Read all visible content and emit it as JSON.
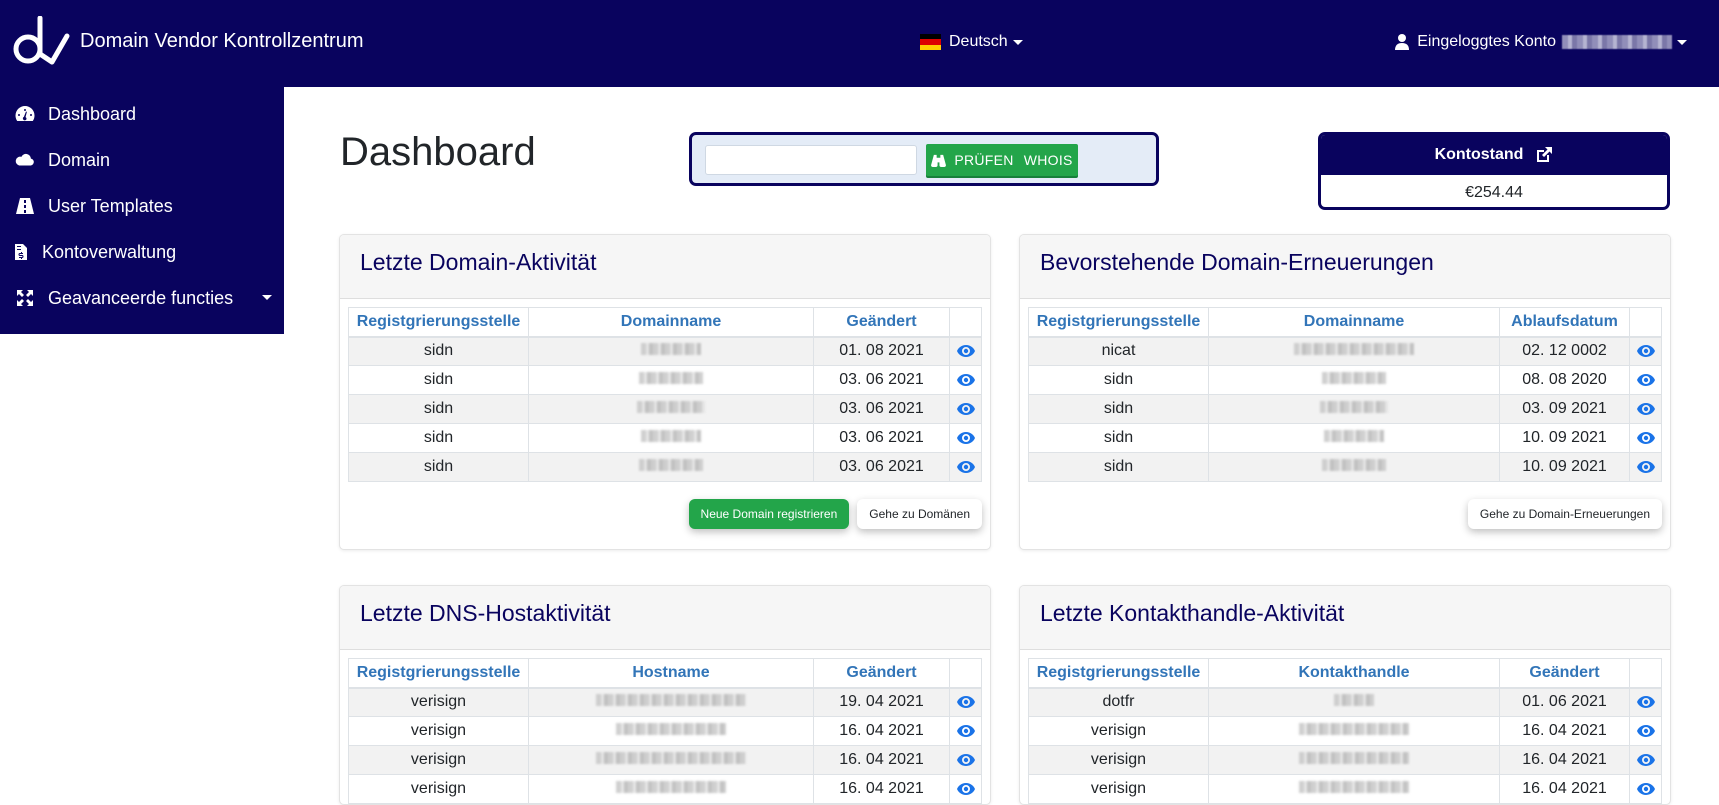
{
  "app": {
    "title": "Domain Vendor Kontrollzentrum",
    "language": "Deutsch",
    "account_label": "Eingeloggtes Konto",
    "account_name_redacted": true
  },
  "sidebar": {
    "items": [
      {
        "label": "Dashboard",
        "icon": "tachometer-icon"
      },
      {
        "label": "Domain",
        "icon": "cloud-icon"
      },
      {
        "label": "User Templates",
        "icon": "road-icon"
      },
      {
        "label": "Kontoverwaltung",
        "icon": "invoice-icon"
      },
      {
        "label": "Geavanceerde functies",
        "icon": "expand-arrows-icon",
        "has_dropdown": true
      }
    ]
  },
  "page": {
    "title": "Dashboard"
  },
  "whois": {
    "input_value": "",
    "button_label_1": "PRÜFEN",
    "button_label_2": "WHOIS"
  },
  "balance": {
    "label": "Kontostand",
    "value": "€254.44"
  },
  "cards": {
    "domain_activity": {
      "title": "Letzte Domain-Aktivität",
      "headers": [
        "Registgrierungsstelle",
        "Domainname",
        "Geändert"
      ],
      "rows": [
        {
          "registry": "sidn",
          "name": "[redacted]",
          "date": "01. 08 2021"
        },
        {
          "registry": "sidn",
          "name": "[redacted]",
          "date": "03. 06 2021"
        },
        {
          "registry": "sidn",
          "name": "[redacted]",
          "date": "03. 06 2021"
        },
        {
          "registry": "sidn",
          "name": "[redacted]",
          "date": "03. 06 2021"
        },
        {
          "registry": "sidn",
          "name": "[redacted]",
          "date": "03. 06 2021"
        }
      ],
      "buttons": [
        "Neue Domain registrieren",
        "Gehe zu Domänen"
      ]
    },
    "renewals": {
      "title": "Bevorstehende Domain-Erneuerungen",
      "headers": [
        "Registgrierungsstelle",
        "Domainname",
        "Ablaufsdatum"
      ],
      "rows": [
        {
          "registry": "nicat",
          "name": "[redacted]",
          "date": "02. 12 0002"
        },
        {
          "registry": "sidn",
          "name": "[redacted]",
          "date": "08. 08 2020"
        },
        {
          "registry": "sidn",
          "name": "[redacted]",
          "date": "03. 09 2021"
        },
        {
          "registry": "sidn",
          "name": "[redacted]",
          "date": "10. 09 2021"
        },
        {
          "registry": "sidn",
          "name": "[redacted]",
          "date": "10. 09 2021"
        }
      ],
      "buttons": [
        "Gehe zu Domain-Erneuerungen"
      ]
    },
    "dns_activity": {
      "title": "Letzte DNS-Hostaktivität",
      "headers": [
        "Registgrierungsstelle",
        "Hostname",
        "Geändert"
      ],
      "rows": [
        {
          "registry": "verisign",
          "name": "[redacted]",
          "date": "19. 04 2021"
        },
        {
          "registry": "verisign",
          "name": "[redacted]",
          "date": "16. 04 2021"
        },
        {
          "registry": "verisign",
          "name": "[redacted]",
          "date": "16. 04 2021"
        },
        {
          "registry": "verisign",
          "name": "[redacted]",
          "date": "16. 04 2021"
        }
      ]
    },
    "contact_activity": {
      "title": "Letzte Kontakthandle-Aktivität",
      "headers": [
        "Registgrierungsstelle",
        "Kontakthandle",
        "Geändert"
      ],
      "rows": [
        {
          "registry": "dotfr",
          "name": "[redacted]",
          "date": "01. 06 2021"
        },
        {
          "registry": "verisign",
          "name": "[redacted]",
          "date": "16. 04 2021"
        },
        {
          "registry": "verisign",
          "name": "[redacted]",
          "date": "16. 04 2021"
        },
        {
          "registry": "verisign",
          "name": "[redacted]",
          "date": "16. 04 2021"
        }
      ]
    }
  },
  "colors": {
    "brand_navy": "#09035e",
    "success_green": "#23a54a",
    "header_blue": "#3275b8",
    "eye_blue": "#1a73e8"
  }
}
